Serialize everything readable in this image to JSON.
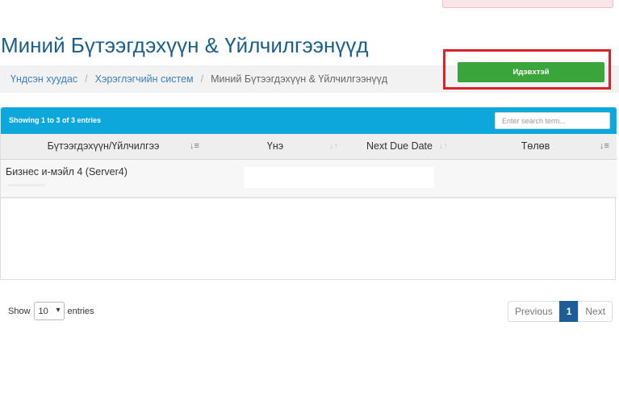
{
  "page": {
    "title": "Миний Бүтээгдэхүүн & Үйлчилгээнүүд"
  },
  "breadcrumb": {
    "items": [
      {
        "label": "Үндсэн хуудас"
      },
      {
        "label": "Хэрэглэгчийн систем"
      },
      {
        "label": "Миний Бүтээгдэхүүн & Үйлчилгээнүүд"
      }
    ]
  },
  "table": {
    "info": "Showing 1 to 3 of 3 entries",
    "search_placeholder": "Enter search term...",
    "columns": [
      {
        "label": "Бүтээгдэхүүн/Үйлчилгээ",
        "sort_icon": "sort-amount-down-icon"
      },
      {
        "label": "Үнэ",
        "sort_icon": "sort-icon"
      },
      {
        "label": "Next Due Date",
        "sort_icon": "sort-icon"
      },
      {
        "label": "Төлөв",
        "sort_icon": "sort-amount-down-icon"
      }
    ],
    "rows": [
      {
        "product": "Бизнес и-мэйл 4 (Server4)",
        "price": "",
        "next_due_date": "",
        "status": "Идэвхтэй"
      }
    ]
  },
  "length_menu": {
    "show_label": "Show",
    "value": "10",
    "entries_label": "entries"
  },
  "pagination": {
    "previous": "Previous",
    "current": "1",
    "next": "Next"
  },
  "colors": {
    "toolbar": "#0da7dc",
    "title": "#1a5e8c",
    "status_active": "#3aa53b",
    "highlight": "#d92229",
    "page_active": "#1f5d96"
  }
}
